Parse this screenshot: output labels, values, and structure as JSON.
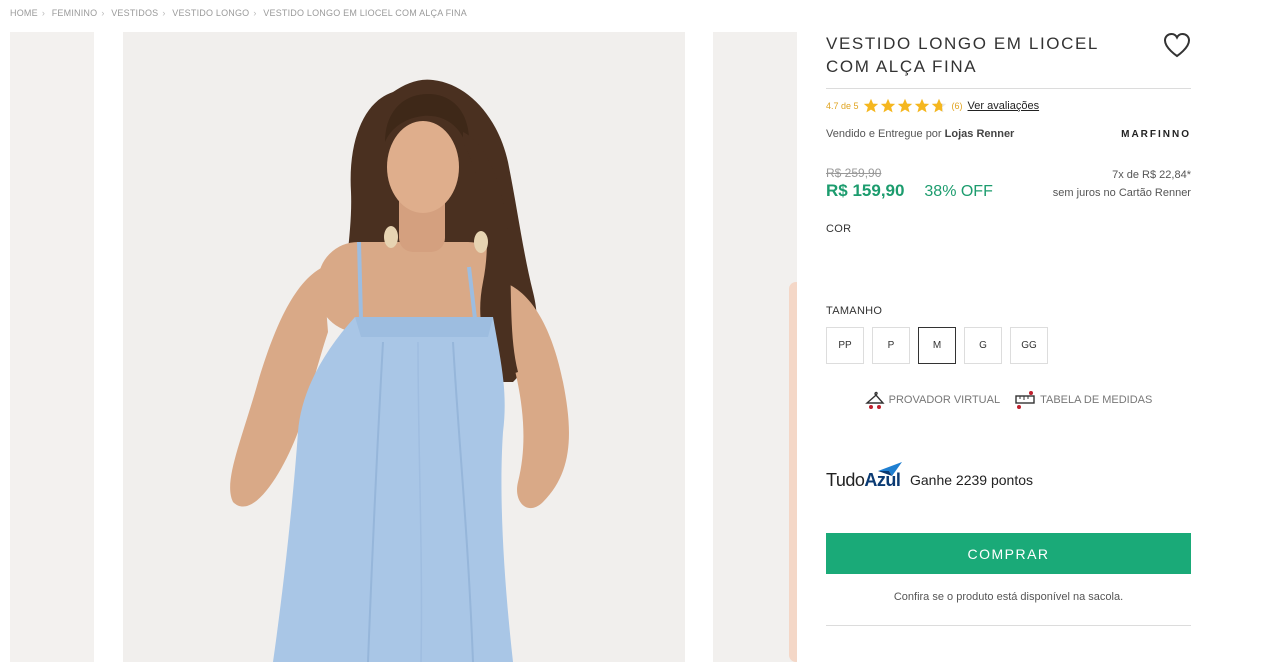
{
  "breadcrumb": [
    "HOME",
    "FEMININO",
    "VESTIDOS",
    "VESTIDO LONGO",
    "VESTIDO LONGO EM LIOCEL COM ALÇA FINA"
  ],
  "product": {
    "title": "VESTIDO LONGO EM LIOCEL COM ALÇA FINA",
    "rating_text": "4.7 de 5",
    "rating_value": 4.7,
    "rating_max": 5,
    "review_count": "(6)",
    "reviews_link": "Ver avaliações",
    "seller_prefix": "Vendido e Entregue por",
    "seller_name": "Lojas Renner",
    "brand": "MARFINNO",
    "old_price": "R$ 259,90",
    "price": "R$ 159,90",
    "discount": "38% OFF",
    "installments": "7x de R$ 22,84*",
    "installments_note": "sem juros no Cartão Renner",
    "color_label": "COR",
    "size_label": "TAMANHO",
    "sizes": [
      "PP",
      "P",
      "M",
      "G",
      "GG"
    ],
    "selected_size": "M",
    "virtual_fitting": "PROVADOR VIRTUAL",
    "size_chart": "TABELA DE MEDIDAS",
    "loyalty_logo_a": "Tudo",
    "loyalty_logo_b": "Azul",
    "loyalty_text": "Ganhe 2239 pontos",
    "buy_label": "COMPRAR",
    "bag_note": "Confira se o produto está disponível na sacola."
  },
  "colors": {
    "accent_green": "#1aaa78",
    "price_green": "#1c9c6e",
    "star": "#f5b71f",
    "dress_blue": "#a9c6e6"
  }
}
